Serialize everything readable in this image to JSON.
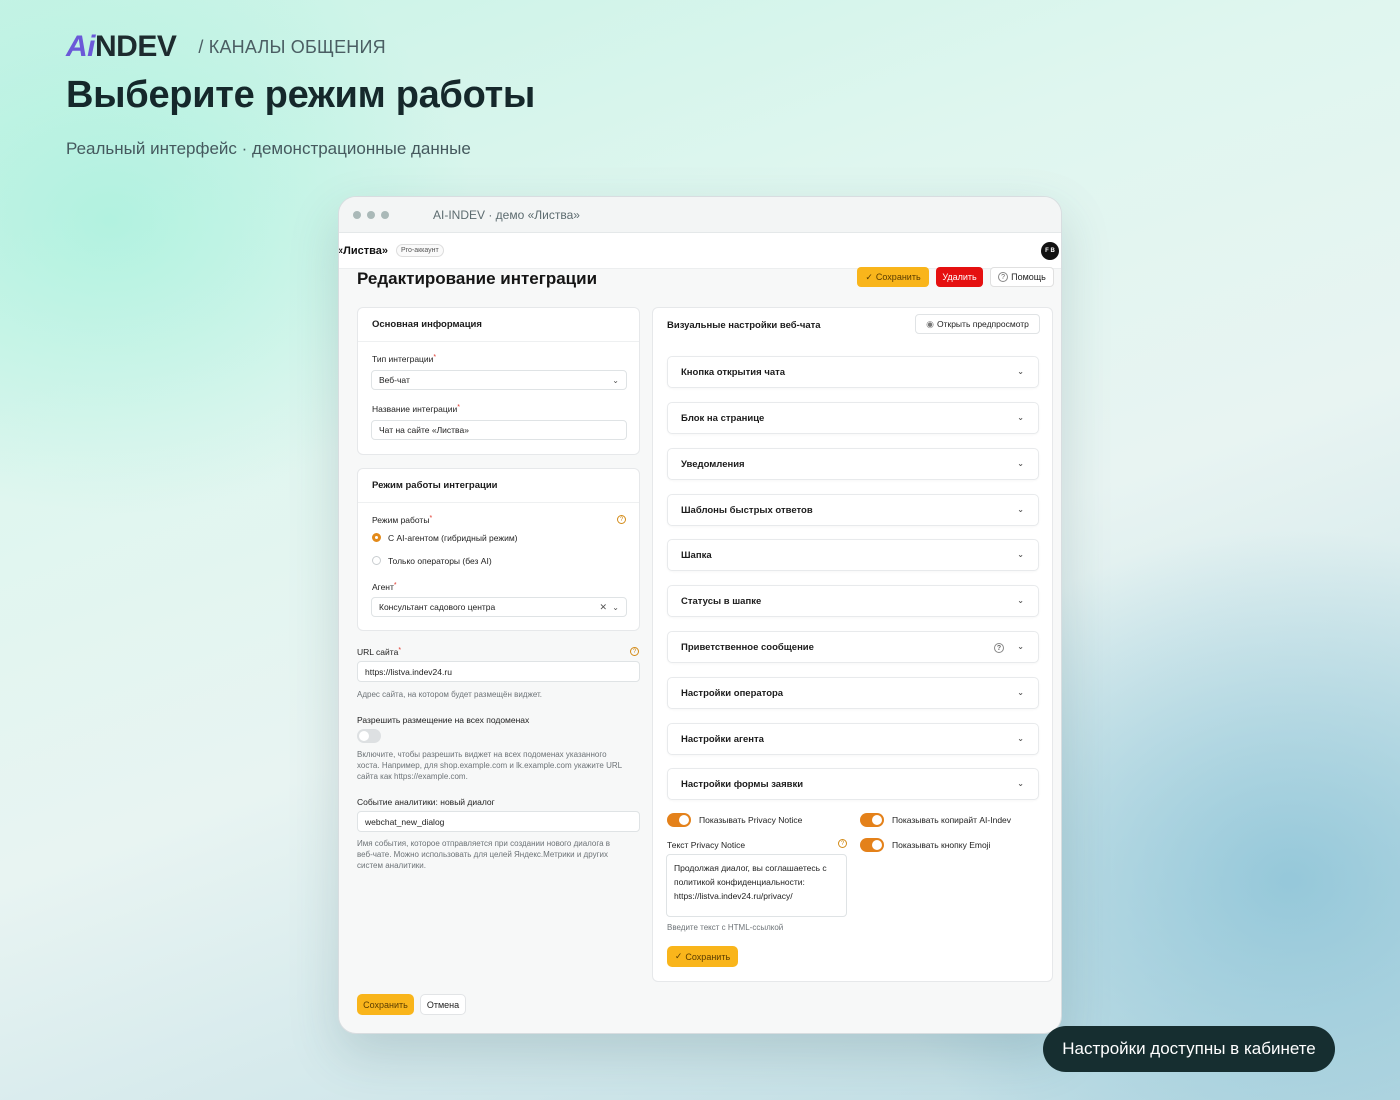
{
  "header": {
    "logo_ai": "Ai",
    "logo_rest": "NDEV",
    "breadcrumb": "/ КАНАЛЫ ОБЩЕНИЯ",
    "title": "Выберите режим работы",
    "subtitle": "Реальный интерфейс · демонстрационные данные"
  },
  "window": {
    "title": "AI-INDEV · демо «Листва»",
    "brand": "«Листва»",
    "badge": "Pro-аккаунт",
    "avatar": "F B"
  },
  "page": {
    "title": "Редактирование интеграции",
    "save_label": "Сохранить",
    "delete_label": "Удалить",
    "help_label": "Помощь"
  },
  "basic": {
    "heading": "Основная информация",
    "type_label": "Тип интеграции",
    "type_value": "Веб-чат",
    "name_label": "Название интеграции",
    "name_value": "Чат на сайте «Листва»"
  },
  "mode": {
    "heading": "Режим работы интеграции",
    "mode_label": "Режим работы",
    "option_ai": "С AI-агентом (гибридный режим)",
    "option_ops": "Только операторы (без AI)",
    "agent_label": "Агент",
    "agent_value": "Консультант садового центра"
  },
  "url": {
    "label": "URL сайта",
    "value": "https://listva.indev24.ru",
    "hint": "Адрес сайта, на котором будет размещён виджет."
  },
  "subdomains": {
    "label": "Разрешить размещение на всех подоменах",
    "enabled": false,
    "hint_line1": "Включите, чтобы разрешить виджет на всех подоменах указанного",
    "hint_line2": "хоста. Например, для shop.example.com и lk.example.com укажите URL",
    "hint_line3": "сайта как https://example.com."
  },
  "analytics": {
    "label": "Событие аналитики: новый диалог",
    "value": "webchat_new_dialog",
    "hint_line1": "Имя события, которое отправляется при создании нового диалога в",
    "hint_line2": "веб-чате. Можно использовать для целей Яндекс.Метрики и других",
    "hint_line3": "систем аналитики."
  },
  "footer": {
    "save_label": "Сохранить",
    "cancel_label": "Отмена"
  },
  "visual": {
    "heading": "Визуальные настройки веб-чата",
    "preview_label": "Открыть предпросмотр",
    "sections": [
      "Кнопка открытия чата",
      "Блок на странице",
      "Уведомления",
      "Шаблоны быстрых ответов",
      "Шапка",
      "Статусы в шапке",
      "Приветственное сообщение",
      "Настройки оператора",
      "Настройки агента",
      "Настройки формы заявки"
    ],
    "toggle_privacy": "Показывать Privacy Notice",
    "toggle_copyright": "Показывать копирайт AI-Indev",
    "toggle_emoji": "Показывать кнопку Emoji",
    "privacy_label": "Текст Privacy Notice",
    "privacy_line1": "Продолжая диалог, вы соглашаетесь с",
    "privacy_line2": "политикой конфиденциальности:",
    "privacy_line3": "https://listva.indev24.ru/privacy/",
    "privacy_hint": "Введите текст с HTML-ссылкой",
    "save_label": "Сохранить"
  },
  "pill": "Настройки доступны в кабинете",
  "colors": {
    "accent_yellow": "#f9b51b",
    "danger_red": "#e51010",
    "toggle_orange": "#e4811a",
    "logo_purple": "#6b58d8"
  }
}
